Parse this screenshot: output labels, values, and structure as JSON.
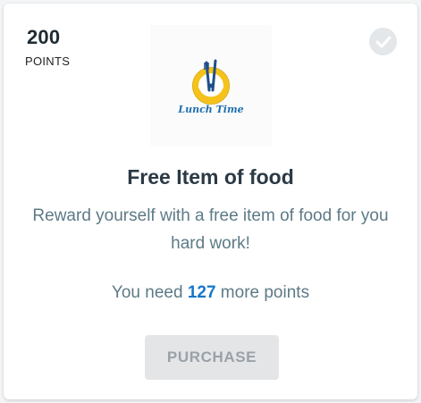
{
  "reward": {
    "points_value": "200",
    "points_label": "POINTS",
    "logo_icon": "lunch-time-clock-fork-knife",
    "logo_text": "Lunch Time",
    "title": "Free Item of food",
    "description": "Reward yourself with a free item of food for you hard work!",
    "need_prefix": "You need",
    "need_count": "127",
    "need_suffix": "more points",
    "purchase_label": "PURCHASE",
    "purchased_check_icon": "checkmark-icon"
  },
  "colors": {
    "accent_blue": "#1677c8",
    "logo_yellow": "#f5c21c",
    "logo_blue": "#1f6fb0",
    "disabled_button": "#e3e5e7",
    "text_muted": "#5d7a86"
  }
}
